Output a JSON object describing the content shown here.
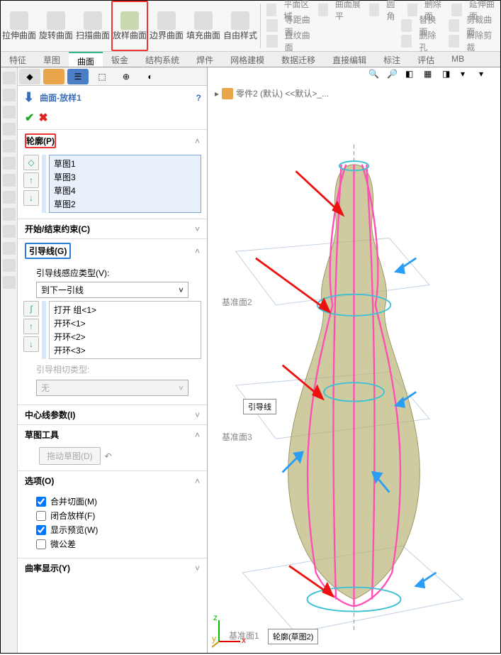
{
  "ribbon": {
    "items": [
      "拉伸曲面",
      "旋转曲面",
      "扫描曲面",
      "放样曲面",
      "边界曲面",
      "填充曲面",
      "自由样式"
    ],
    "right_rows": [
      [
        "平面区域",
        "",
        "曲面展平",
        "圆角",
        "删除面",
        "延伸曲面"
      ],
      [
        "等距曲面",
        "",
        "",
        "",
        "替换面",
        "剪裁曲面"
      ],
      [
        "直纹曲面",
        "",
        "",
        "",
        "删除孔",
        "解除剪裁"
      ]
    ]
  },
  "tabs": [
    "特征",
    "草图",
    "曲面",
    "钣金",
    "结构系统",
    "焊件",
    "网格建模",
    "数据迁移",
    "直接编辑",
    "标注",
    "评估",
    "MB"
  ],
  "active_tab": "曲面",
  "feature": {
    "title": "曲面-放样1",
    "help": "?"
  },
  "sections": {
    "profile": {
      "title": "轮廓(P)",
      "items": [
        "草图1",
        "草图3",
        "草图4",
        "草图2"
      ]
    },
    "constraint": {
      "title": "开始/结束约束(C)"
    },
    "guides": {
      "title": "引导线(G)",
      "sensing_label": "引导线感应类型(V):",
      "sensing_value": "到下一引线",
      "items": [
        "打开 组<1>",
        "开环<1>",
        "开环<2>",
        "开环<3>"
      ],
      "tangent_label": "引导相切类型:",
      "tangent_value": "无"
    },
    "centerline": {
      "title": "中心线参数(I)"
    },
    "sketch_tools": {
      "title": "草图工具",
      "drag_btn": "拖动草图(D)"
    },
    "options": {
      "title": "选项(O)",
      "merge": "合并切面(M)",
      "close": "闭合放样(F)",
      "preview": "显示预览(W)",
      "micro": "微公差"
    },
    "curvature": {
      "title": "曲率显示(Y)"
    }
  },
  "breadcrumb": {
    "part": "零件2 (默认) <<默认>_..."
  },
  "callouts": {
    "guide": "引导线",
    "profile": "轮廓(草图2)"
  },
  "planes": {
    "p1": "基准面1",
    "p2": "基准面2",
    "p3": "基准面3"
  }
}
